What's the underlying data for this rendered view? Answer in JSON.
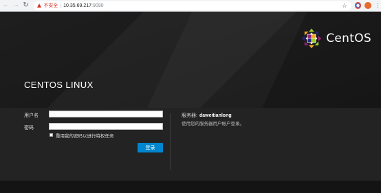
{
  "browser": {
    "insecure_label": "不安全",
    "url_host": "10.35.69.217",
    "url_port": ":9090"
  },
  "brand": {
    "name": "CentOS"
  },
  "page": {
    "os_title": "CENTOS LINUX"
  },
  "login": {
    "username_label": "用户名",
    "username_value": "",
    "password_label": "密码",
    "password_value": "",
    "reuse_password_label": "重用我的密码以进行特权任务",
    "reuse_password_checked": false,
    "login_button": "登录"
  },
  "server": {
    "label": "服务器:",
    "name": "daweitianlong",
    "hint": "使用您的服务器用户帐户登录。"
  },
  "colors": {
    "accent_button": "#0085cf",
    "insecure_red": "#d93025",
    "page_background": "#151515",
    "panel_background": "#232323"
  },
  "icons": [
    "back-arrow-icon",
    "forward-arrow-icon",
    "reload-icon",
    "warning-triangle-icon",
    "bookmark-star-icon",
    "extension-icon",
    "profile-avatar-icon",
    "browser-menu-icon",
    "centos-logo-icon"
  ]
}
